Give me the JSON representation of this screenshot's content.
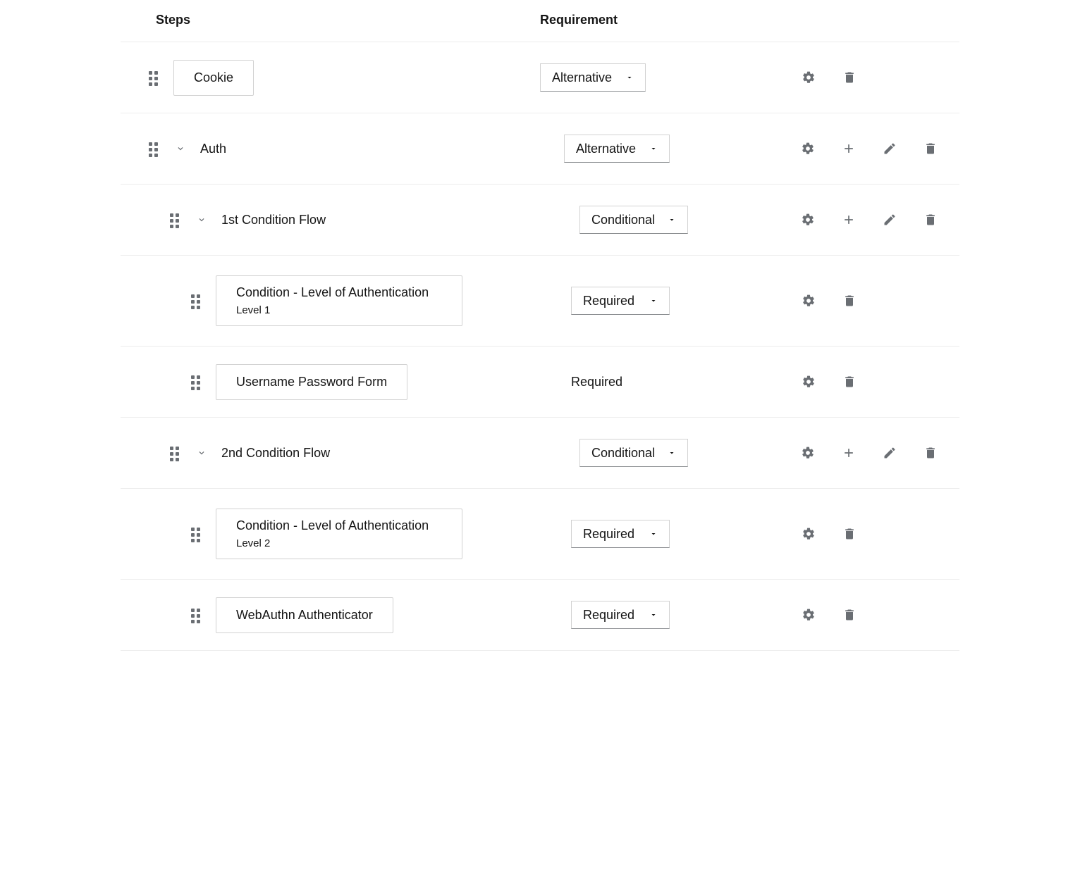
{
  "header": {
    "steps_label": "Steps",
    "requirement_label": "Requirement"
  },
  "rows": {
    "cookie": {
      "name": "Cookie",
      "requirement": "Alternative"
    },
    "auth": {
      "name": "Auth",
      "requirement": "Alternative"
    },
    "cond1": {
      "name": "1st Condition Flow",
      "requirement": "Conditional"
    },
    "cond1_level": {
      "name": "Condition - Level of Authentication",
      "sub": "Level 1",
      "requirement": "Required"
    },
    "upform": {
      "name": "Username Password Form",
      "requirement": "Required"
    },
    "cond2": {
      "name": "2nd Condition Flow",
      "requirement": "Conditional"
    },
    "cond2_level": {
      "name": "Condition - Level of Authentication",
      "sub": "Level 2",
      "requirement": "Required"
    },
    "webauthn": {
      "name": "WebAuthn Authenticator",
      "requirement": "Required"
    }
  }
}
